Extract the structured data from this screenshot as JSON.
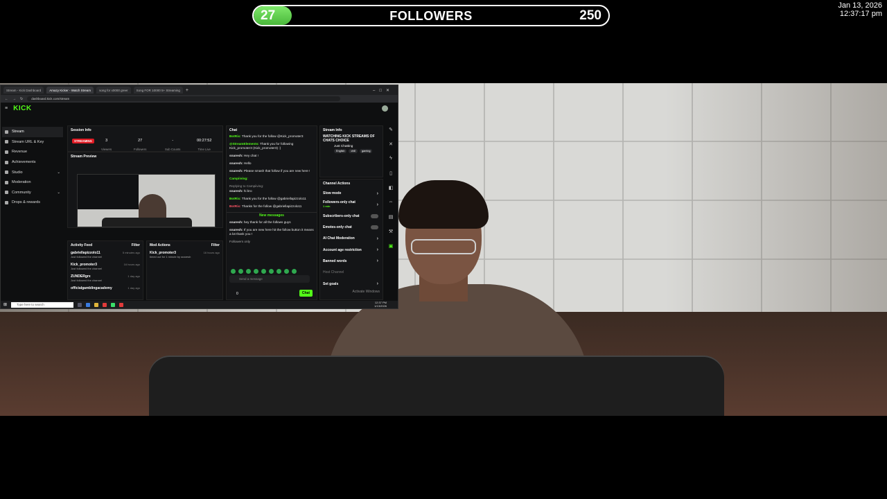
{
  "overlay": {
    "followers": {
      "current": "27",
      "title": "FOLLOWERS",
      "goal": "250",
      "progress_fraction": 0.108
    },
    "clock": {
      "date": "Jan 13, 2026",
      "time": "12:37:17 pm"
    }
  },
  "browser": {
    "tabs": [
      {
        "label": "Stream - Kick Dashboard"
      },
      {
        "label": "Amazy Kicker - Watch Stream"
      },
      {
        "label": "song for x0000 greer"
      },
      {
        "label": "Song FOR 10000 5+ Streaming"
      }
    ],
    "url": "dashboard.kick.com/stream"
  },
  "kick": {
    "logo": "KICK",
    "sidebar": [
      {
        "label": "Stream",
        "active": true
      },
      {
        "label": "Stream URL & Key"
      },
      {
        "label": "Revenue"
      },
      {
        "label": "Achievements"
      },
      {
        "label": "Studio"
      },
      {
        "label": "Moderation"
      },
      {
        "label": "Community"
      },
      {
        "label": "Drops & rewards"
      }
    ],
    "session_info": {
      "title": "Session Info",
      "status": "STREAMING",
      "stats": [
        {
          "value": "3",
          "label": "Viewers"
        },
        {
          "value": "27",
          "label": "Followers"
        },
        {
          "value": "-",
          "label": "Sub Counts"
        },
        {
          "value": "00:27:52",
          "label": "Time Live"
        }
      ]
    },
    "stream_preview": {
      "title": "Stream Preview"
    },
    "chat": {
      "title": "Chat",
      "messages": [
        {
          "user": "BotRix:",
          "text": " Thank you for the follow @Kick_promoter3",
          "style": "green"
        },
        {
          "user": "@StreamElements:",
          "text": " Thank you for following Kick_promoter3 (Kick_promoter3) :)",
          "style": "green"
        },
        {
          "user": "snaresh:",
          "text": " Hey chat !",
          "style": "white"
        },
        {
          "user": "snaresh:",
          "text": " Hello",
          "style": "white"
        },
        {
          "user": "snaresh:",
          "text": " Please smash that follow if you are new here !",
          "style": "white"
        },
        {
          "user": "Campiiving:",
          "text": "",
          "style": "green"
        },
        {
          "user": "snaresh:",
          "text": " hi bro",
          "style": "white"
        },
        {
          "user": "BotRix:",
          "text": " Thank you for the follow @gabriellapizzolo11",
          "style": "green"
        },
        {
          "user": "BotRix:",
          "text": " Thanks for the follow @gabriellapizzolo11",
          "style": "red"
        }
      ],
      "reply_hint": "Replying to Campiiving:",
      "new_messages_label": "New messages",
      "new_messages": [
        {
          "user": "snaresh:",
          "text": " hey thank for all the follows guys"
        },
        {
          "user": "snaresh:",
          "text": " If you are new here hit the follow button it means a lot thank you !"
        }
      ],
      "followers_only": "Followers only",
      "input_placeholder": "Send a message",
      "send_label": "Chat",
      "points": "0"
    },
    "stream_info": {
      "title": "Stream Info",
      "stream_title": "WATCHING KICK STREAMS OF CHATS CHOICE",
      "category": "Just Chatting",
      "tags": [
        "English",
        "chill",
        "gaming"
      ]
    },
    "channel_actions": {
      "title": "Channel Actions",
      "items": [
        {
          "label": "Slow mode",
          "control": "chevron"
        },
        {
          "label": "Followers-only chat",
          "sub": "1 min",
          "control": "chevron"
        },
        {
          "label": "Subscribers-only chat",
          "control": "toggle"
        },
        {
          "label": "Emotes-only chat",
          "control": "toggle"
        },
        {
          "label": "AI Chat Moderation",
          "control": "chevron"
        },
        {
          "label": "Account age restriction",
          "control": "chevron"
        },
        {
          "label": "Banned words",
          "control": "chevron"
        },
        {
          "label": "Host Channel",
          "control": "none"
        },
        {
          "label": "Set goals",
          "control": "chevron"
        }
      ]
    },
    "activity_feed": {
      "title": "Activity Feed",
      "filter_label": "Filter",
      "items": [
        {
          "name": "gabriellapizzolo11",
          "sub": "Just followed the channel",
          "time": "5 minutes ago"
        },
        {
          "name": "Kick_promoter3",
          "sub": "Just followed the channel",
          "time": "16 hours ago"
        },
        {
          "name": "ZUNDERgrx",
          "sub": "Just followed the channel",
          "time": "1 day ago"
        },
        {
          "name": "officialgamblingacademy",
          "sub": "",
          "time": "1 day ago"
        }
      ]
    },
    "mod_actions": {
      "title": "Mod Actions",
      "filter_label": "Filter",
      "items": [
        {
          "name": "Kick_promoter3",
          "sub": "timed out for 1 minute by snaresh",
          "time": "16 hours ago"
        }
      ]
    }
  },
  "taskbar": {
    "search_placeholder": "Type here to search",
    "time": "12:37 PM",
    "date": "1/13/2026",
    "activate_windows": "Activate Windows"
  }
}
